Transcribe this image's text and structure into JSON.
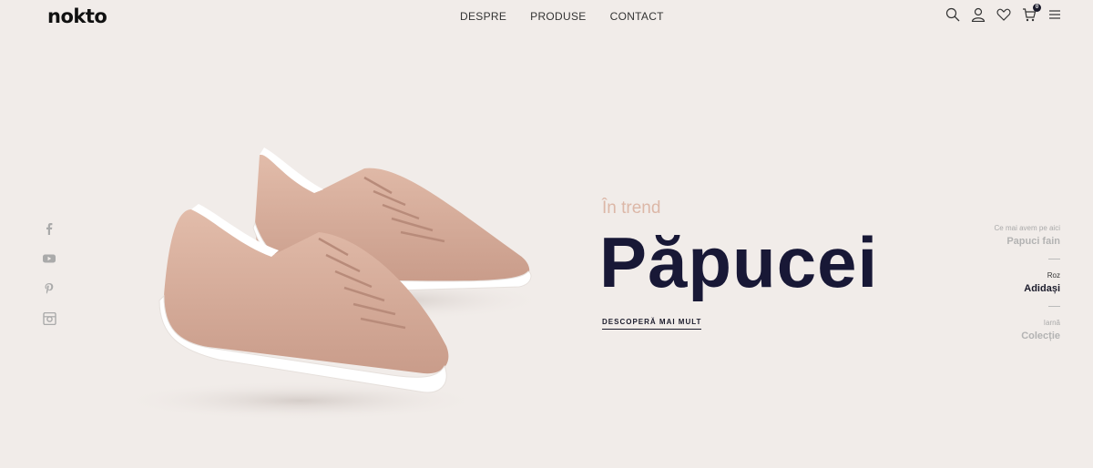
{
  "brand": {
    "logo": "nokto"
  },
  "nav": {
    "items": [
      "DESPRE",
      "PRODUSE",
      "CONTACT"
    ]
  },
  "header": {
    "icons": [
      "search-icon",
      "user-icon",
      "heart-icon",
      "cart-icon",
      "menu-icon"
    ],
    "cart_count": "0"
  },
  "social": {
    "icons": [
      "facebook-icon",
      "youtube-icon",
      "pinterest-icon",
      "instagram-icon"
    ]
  },
  "hero": {
    "eyebrow": "În trend",
    "title": "Păpucei",
    "cta": "DESCOPERĂ MAI MULT",
    "accent_color": "#dcb7a7",
    "title_color": "#181836"
  },
  "side": {
    "items": [
      {
        "small": "Ce mai avem pe aici",
        "big": "Papuci fain"
      },
      {
        "small": "Roz",
        "big": "Adidași"
      },
      {
        "small": "Iarnă",
        "big": "Colecție"
      }
    ]
  }
}
